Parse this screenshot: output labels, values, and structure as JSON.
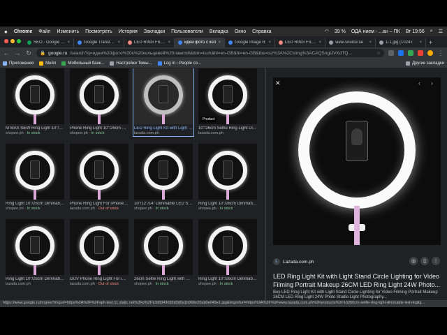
{
  "menubar": {
    "apple": "",
    "app": "Chrome",
    "items": [
      "Файл",
      "Изменить",
      "Посмотреть",
      "История",
      "Закладки",
      "Пользователи",
      "Вкладка",
      "Окно",
      "Справка"
    ],
    "battery": "39 %",
    "user": "ОДА нием - ...ан – ПК",
    "clock": "Вт 19:56"
  },
  "tabs": [
    {
      "label": "SEO - Google Sh",
      "color": "#0f9d58"
    },
    {
      "label": "Google Translate",
      "color": "#4285f4"
    },
    {
      "label": "LED RING FILL L",
      "color": "#f28b82"
    },
    {
      "label": "идеи фото с кол",
      "color": "#4285f4",
      "active": true
    },
    {
      "label": "Google Image R",
      "color": "#4285f4"
    },
    {
      "label": "LED RING FILL L",
      "color": "#f28b82"
    },
    {
      "label": "view-source:se",
      "color": "#9aa0a6"
    },
    {
      "label": "1-1.jpg (1024×",
      "color": "#9aa0a6"
    }
  ],
  "address": {
    "host": "google.ru",
    "path": "/search?q=идеи%20фото%20с%20кольцевой%20лампой&tbm=isch&hl=en-GB&hl=en-GB&tbs=isz%3A%2Csimg%3ACAQSngIJVKdTQ..."
  },
  "bookmarks": {
    "items": [
      "Приложения",
      "Мейл",
      "Мобильный банк...",
      "Настройки Темы...",
      "Log in ‹ People co..."
    ],
    "other": "Другие закладки"
  },
  "results": [
    {
      "title": "M MAX NEW Ring Light 10\"/26cm...",
      "source": "shopee.ph",
      "status": "In stock",
      "instock": true
    },
    {
      "title": "Phone Ring Light 10\"/26cm Di...",
      "source": "shopee.ph",
      "status": "In stock",
      "instock": true
    },
    {
      "title": "LED Ring Light Kit with Light St...",
      "source": "lazada.com.ph",
      "status": "",
      "selected": true
    },
    {
      "title": "10\"/26cm Selfie Ring Light Di...",
      "source": "lazada.com.ph",
      "status": "",
      "product": true
    },
    {
      "title": "Ring Light 10\"/26cm Dimmable...",
      "source": "shopee.ph",
      "status": "In stock",
      "instock": true
    },
    {
      "title": "Phone Ring Light For iPhone X...",
      "source": "lazada.com.ph",
      "status": "Out of stock",
      "instock": false
    },
    {
      "title": "10\"/12\"/14\" Dimmable LED Stu...",
      "source": "shopee.ph",
      "status": "In stock",
      "instock": true
    },
    {
      "title": "Ring Light 10\"/26cm Dimmable...",
      "source": "shopee.ph",
      "status": "In stock",
      "instock": true
    },
    {
      "title": "Ring Light 10\"/26cm Dimmable...",
      "source": "lazada.com.ph",
      "status": "",
      "instock": true
    },
    {
      "title": "GUV Phone Ring Light For iPho...",
      "source": "lazada.com.ph",
      "status": "Out of stock",
      "instock": false
    },
    {
      "title": "26cm Selfie Ring Light with Ce...",
      "source": "shopee.ph",
      "status": "In stock",
      "instock": true
    },
    {
      "title": "Ring Light 10\"/26cm Dimmable...",
      "source": "shopee.ph",
      "status": "In stock",
      "instock": true
    }
  ],
  "product_badge": "Product",
  "panel": {
    "source": "Lazada.com.ph",
    "title": "LED Ring Light Kit with Light Stand Circle Lighting for Video Filming Portrait Makeup 26CM LED Ring Light 24W Photo...",
    "description": "Buy LED Ring Light Kit with Light Stand Circle Lighting for Video Filming Portrait Makeup 26CM LED Ring Light 24W Photo Studio Light Photography..."
  },
  "status_url": "https://www.google.ru/imgres?imgurl=https%3A%2F%2Fsph-test-11.slatic.net%2Fp%2F13d9343693d3d0a1b968e20ab0e045e1.jpg&imgrefurl=https%3A%2F%2Fwww.lazada.com.ph%2Fproducts%2F10260cm-selfie-ring-light-dimmable-led-ringlig..."
}
